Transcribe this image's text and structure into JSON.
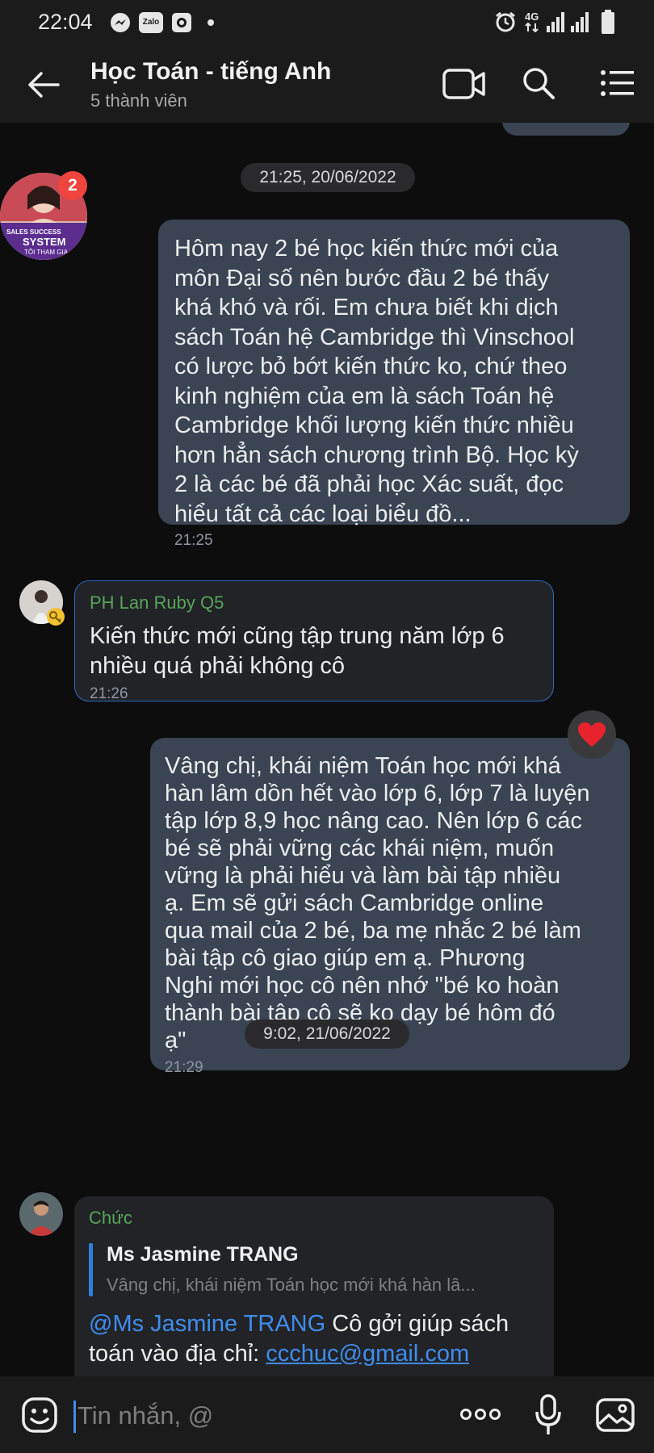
{
  "status_bar": {
    "time": "22:04",
    "notification_icons": [
      "messenger-icon",
      "zalo-icon",
      "camera-app-icon",
      "dot"
    ],
    "zalo_label": "Zalo",
    "network": "4G",
    "system_icons": [
      "alarm-icon",
      "signal-icon",
      "signal-icon",
      "battery-icon"
    ]
  },
  "header": {
    "title": "Học Toán - tiếng Anh",
    "subtitle": "5 thành viên",
    "icons": [
      "back-arrow-icon",
      "video-call-icon",
      "search-icon",
      "menu-icon"
    ]
  },
  "avatar_badge": "2",
  "avatar_banner": {
    "line1": "SALES SUCCESS",
    "line2": "SYSTEM",
    "line3": "TÔI THAM GIA"
  },
  "dates": {
    "first": "21:25, 20/06/2022",
    "second": "9:02, 21/06/2022"
  },
  "messages": [
    {
      "sender": "",
      "lines": [
        "Hôm nay 2 bé học kiến thức mới của",
        "môn Đại số nên bước đầu 2 bé thấy",
        "khá khó và rối. Em chưa biết khi dịch",
        "sách Toán hệ Cambridge thì Vinschool",
        "có lược bỏ bớt kiến thức ko, chứ theo",
        "kinh nghiệm của em là sách Toán hệ",
        "Cambridge khối lượng kiến thức nhiều",
        "hơn hẳn sách chương trình Bộ. Học kỳ",
        "2 là các bé đã phải học Xác suất, đọc",
        "hiểu tất cả các loại biểu đồ..."
      ],
      "time": "21:25"
    },
    {
      "sender": "PH Lan Ruby Q5",
      "lines": [
        "Kiến thức mới cũng tập trung năm lớp 6",
        "nhiều quá phải không cô"
      ],
      "time": "21:26"
    },
    {
      "sender": "",
      "lines": [
        "Vâng chị, khái niệm Toán học mới khá",
        "hàn lâm dồn hết vào lớp 6, lớp 7 là luyện",
        "tập lớp 8,9 học nâng cao. Nên lớp 6 các",
        "bé sẽ phải vững các khái niệm, muốn",
        "vững là phải hiểu và làm bài tập nhiều",
        "ạ.  Em sẽ gửi sách Cambridge online",
        "qua mail của 2 bé, ba mẹ nhắc 2 bé làm",
        "bài tập cô giao giúp em ạ.  Phương",
        "Nghi mới học cô nên nhớ \"bé ko hoàn",
        "thành bài tập cô sẽ ko dạy bé hôm đó",
        "ạ\""
      ],
      "time": "21:29",
      "reaction": "heart-icon"
    },
    {
      "sender": "Chức",
      "quote": {
        "author": "Ms Jasmine TRANG",
        "text": "Vâng chị, khái niệm Toán học mới khá hàn lâ..."
      },
      "mention": "@Ms Jasmine TRANG",
      "line1_rest": " Cô gởi giúp sách",
      "line2_prefix": "toán vào địa chỉ: ",
      "email": "ccchuc@gmail.com"
    }
  ],
  "input": {
    "placeholder": "Tin nhắn, @",
    "icons": [
      "emoji-icon",
      "more-dots-icon",
      "microphone-icon",
      "image-icon"
    ]
  },
  "colors": {
    "background": "#0d0d0d",
    "bar": "#1b1b1b",
    "my_bubble": "#3a4452",
    "their_bubble": "#222326",
    "sender_green": "#57a55a",
    "link_blue": "#3f8df0",
    "heart_red": "#e8232e"
  }
}
